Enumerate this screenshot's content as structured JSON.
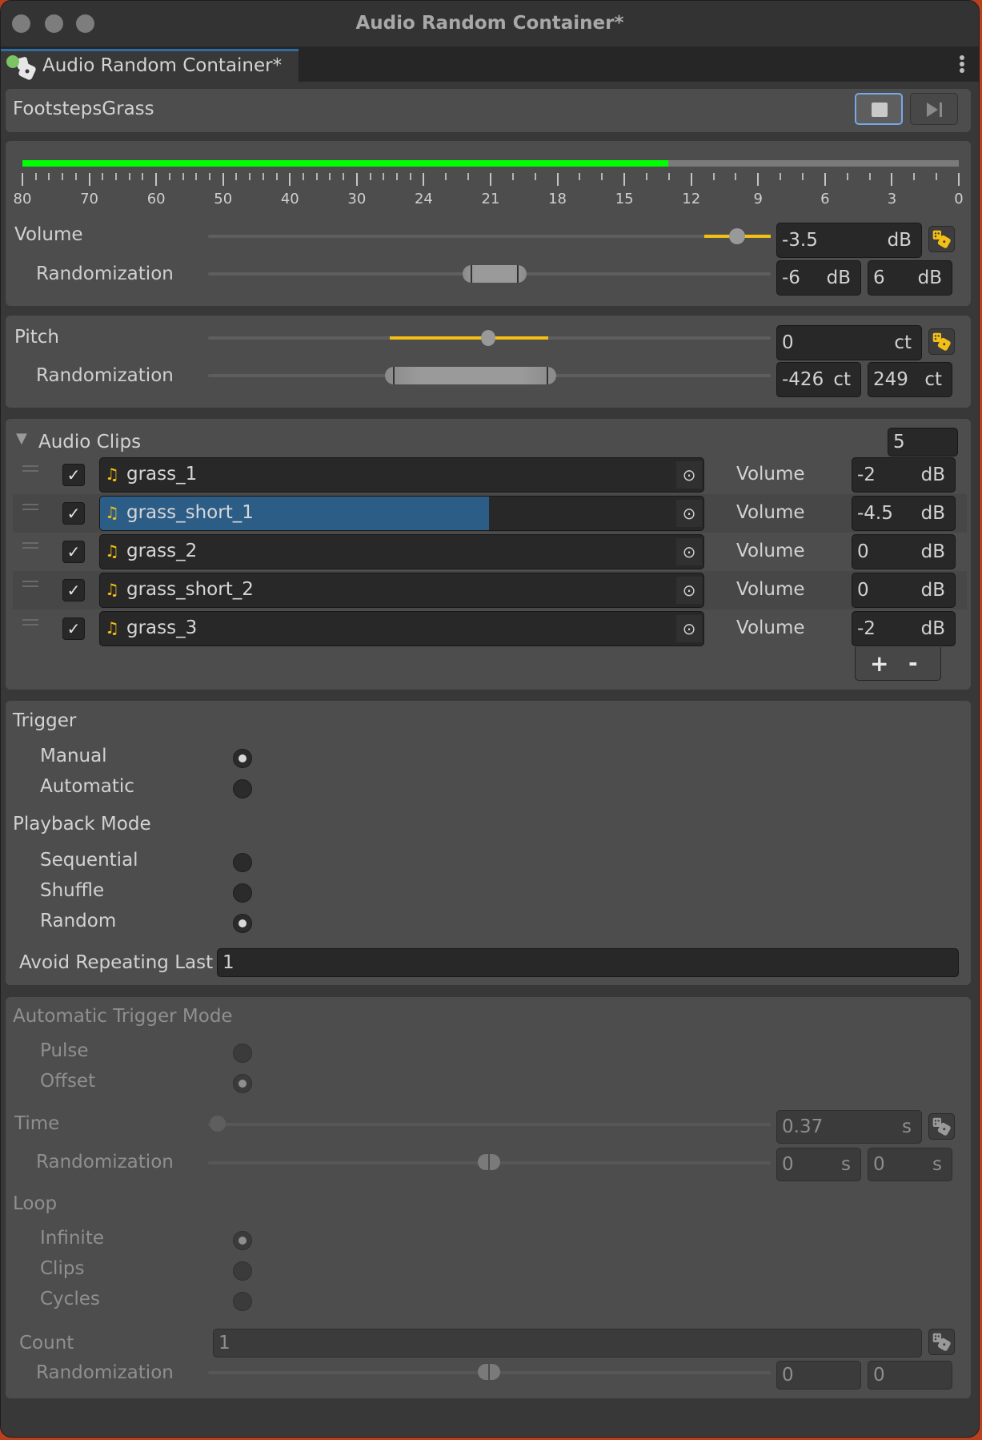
{
  "window": {
    "title": "Audio Random Container*",
    "tab_label": "Audio Random Container*"
  },
  "header": {
    "asset_name": "FootstepsGrass",
    "stop_button": "stop-icon",
    "skip_button": "skip-forward-icon"
  },
  "meter": {
    "level_fraction": 0.69,
    "scale_labels": [
      "80",
      "70",
      "60",
      "50",
      "40",
      "30",
      "24",
      "21",
      "18",
      "15",
      "12",
      "9",
      "6",
      "3",
      "0"
    ],
    "colors": {
      "level": "#00ff00",
      "background": "#7a7a7a"
    }
  },
  "volume": {
    "label": "Volume",
    "value": "-3.5",
    "unit": "dB",
    "randomization_label": "Randomization",
    "rand_min": "-6",
    "rand_max": "6",
    "rand_unit": "dB"
  },
  "pitch": {
    "label": "Pitch",
    "value": "0",
    "unit": "ct",
    "randomization_label": "Randomization",
    "rand_min": "-426",
    "rand_max": "249",
    "rand_unit": "ct"
  },
  "audio_clips": {
    "title": "Audio Clips",
    "count": "5",
    "volume_label": "Volume",
    "unit": "dB",
    "items": [
      {
        "name": "grass_1",
        "enabled": true,
        "volume": "-2"
      },
      {
        "name": "grass_short_1",
        "enabled": true,
        "volume": "-4.5",
        "selected": true
      },
      {
        "name": "grass_2",
        "enabled": true,
        "volume": "0"
      },
      {
        "name": "grass_short_2",
        "enabled": true,
        "volume": "0"
      },
      {
        "name": "grass_3",
        "enabled": true,
        "volume": "-2"
      }
    ],
    "add_label": "+",
    "remove_label": "-"
  },
  "trigger": {
    "title": "Trigger",
    "options": [
      {
        "label": "Manual",
        "selected": true
      },
      {
        "label": "Automatic",
        "selected": false
      }
    ]
  },
  "playback_mode": {
    "title": "Playback Mode",
    "options": [
      {
        "label": "Sequential",
        "selected": false
      },
      {
        "label": "Shuffle",
        "selected": false
      },
      {
        "label": "Random",
        "selected": true
      }
    ]
  },
  "avoid_repeating": {
    "label": "Avoid Repeating Last",
    "value": "1"
  },
  "automatic_trigger": {
    "title": "Automatic Trigger Mode",
    "options": [
      {
        "label": "Pulse",
        "selected": false
      },
      {
        "label": "Offset",
        "selected": true
      }
    ],
    "time_label": "Time",
    "time_value": "0.37",
    "time_unit": "s",
    "time_randomization_label": "Randomization",
    "time_rand_min": "0",
    "time_rand_max": "0",
    "loop_title": "Loop",
    "loop_options": [
      {
        "label": "Infinite",
        "selected": true
      },
      {
        "label": "Clips",
        "selected": false
      },
      {
        "label": "Cycles",
        "selected": false
      }
    ],
    "count_label": "Count",
    "count_value": "1",
    "count_randomization_label": "Randomization",
    "count_rand_min": "0",
    "count_rand_max": "0"
  }
}
